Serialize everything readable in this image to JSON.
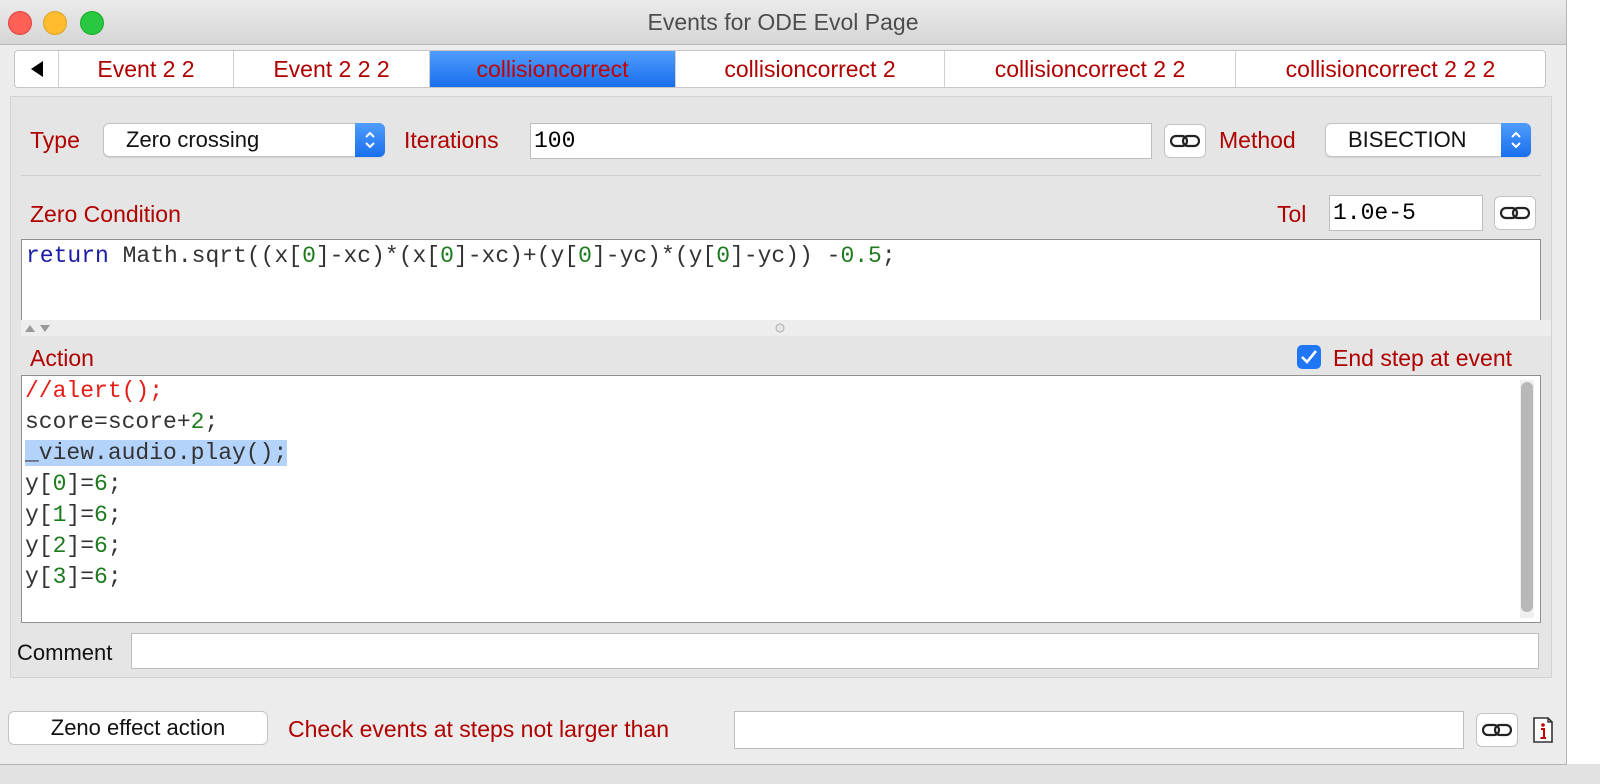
{
  "window": {
    "title": "Events for ODE Evol Page"
  },
  "tabs": [
    {
      "label": "Event 2 2",
      "active": false
    },
    {
      "label": "Event 2 2 2",
      "active": false
    },
    {
      "label": "collisioncorrect",
      "active": true
    },
    {
      "label": "collisioncorrect 2",
      "active": false
    },
    {
      "label": "collisioncorrect 2 2",
      "active": false
    },
    {
      "label": "collisioncorrect 2 2 2",
      "active": false
    }
  ],
  "event": {
    "type_label": "Type",
    "type_value": "Zero crossing",
    "iterations_label": "Iterations",
    "iterations_value": "100",
    "method_label": "Method",
    "method_value": "BISECTION",
    "zero_condition_label": "Zero Condition",
    "tol_label": "Tol",
    "tol_value": "1.0e-5",
    "zero_condition_code": "return Math.sqrt((x[0]-xc)*(x[0]-xc)+(y[0]-yc)*(y[0]-yc)) -0.5;",
    "action_label": "Action",
    "end_step_label": "End step at event",
    "end_step_checked": true,
    "action_code": [
      "//alert();",
      "score=score+2;",
      "_view.audio.play();",
      "y[0]=6;",
      "y[1]=6;",
      "y[2]=6;",
      "y[3]=6;"
    ],
    "comment_label": "Comment",
    "comment_value": ""
  },
  "footer": {
    "zeno_button": "Zeno effect action",
    "check_label": "Check events at steps not larger than",
    "check_value": ""
  },
  "colors": {
    "label_red": "#b00000",
    "accent_blue": "#1a6fee",
    "keyword": "#1a1aa6",
    "number": "#1e7a1e",
    "comment": "#e41b17"
  },
  "icons": [
    "back-arrow-icon",
    "chevron-updown-icon",
    "link-icon",
    "checkmark-icon",
    "info-icon"
  ]
}
